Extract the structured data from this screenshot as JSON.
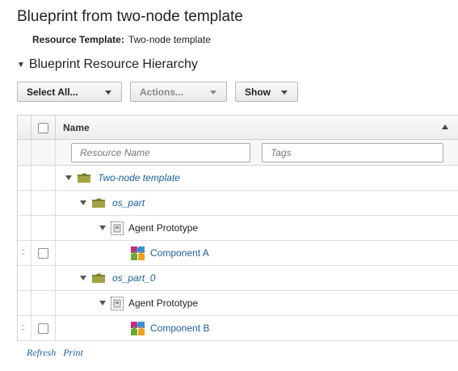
{
  "page": {
    "title": "Blueprint from two-node template",
    "resource_template_label": "Resource Template:",
    "resource_template_value": "Two-node template",
    "section_title": "Blueprint Resource Hierarchy"
  },
  "toolbar": {
    "select_all_label": "Select All...",
    "actions_label": "Actions...",
    "show_label": "Show"
  },
  "grid": {
    "header": {
      "name": "Name"
    },
    "filters": {
      "resource_name_placeholder": "Resource Name",
      "tags_placeholder": "Tags"
    },
    "rows": [
      {
        "label": "Two-node template",
        "kind": "folder",
        "level": 0
      },
      {
        "label": "os_part",
        "kind": "folder",
        "level": 1
      },
      {
        "label": "Agent Prototype",
        "kind": "agent",
        "level": 2
      },
      {
        "label": "Component A",
        "kind": "component",
        "level": 3
      },
      {
        "label": "os_part_0",
        "kind": "folder",
        "level": 1
      },
      {
        "label": "Agent Prototype",
        "kind": "agent",
        "level": 2
      },
      {
        "label": "Component B",
        "kind": "component",
        "level": 3
      }
    ]
  },
  "footer": {
    "refresh_label": "Refresh",
    "print_label": "Print"
  },
  "colors": {
    "link": "#1f5fa0",
    "folder": "#8c8c3a"
  }
}
